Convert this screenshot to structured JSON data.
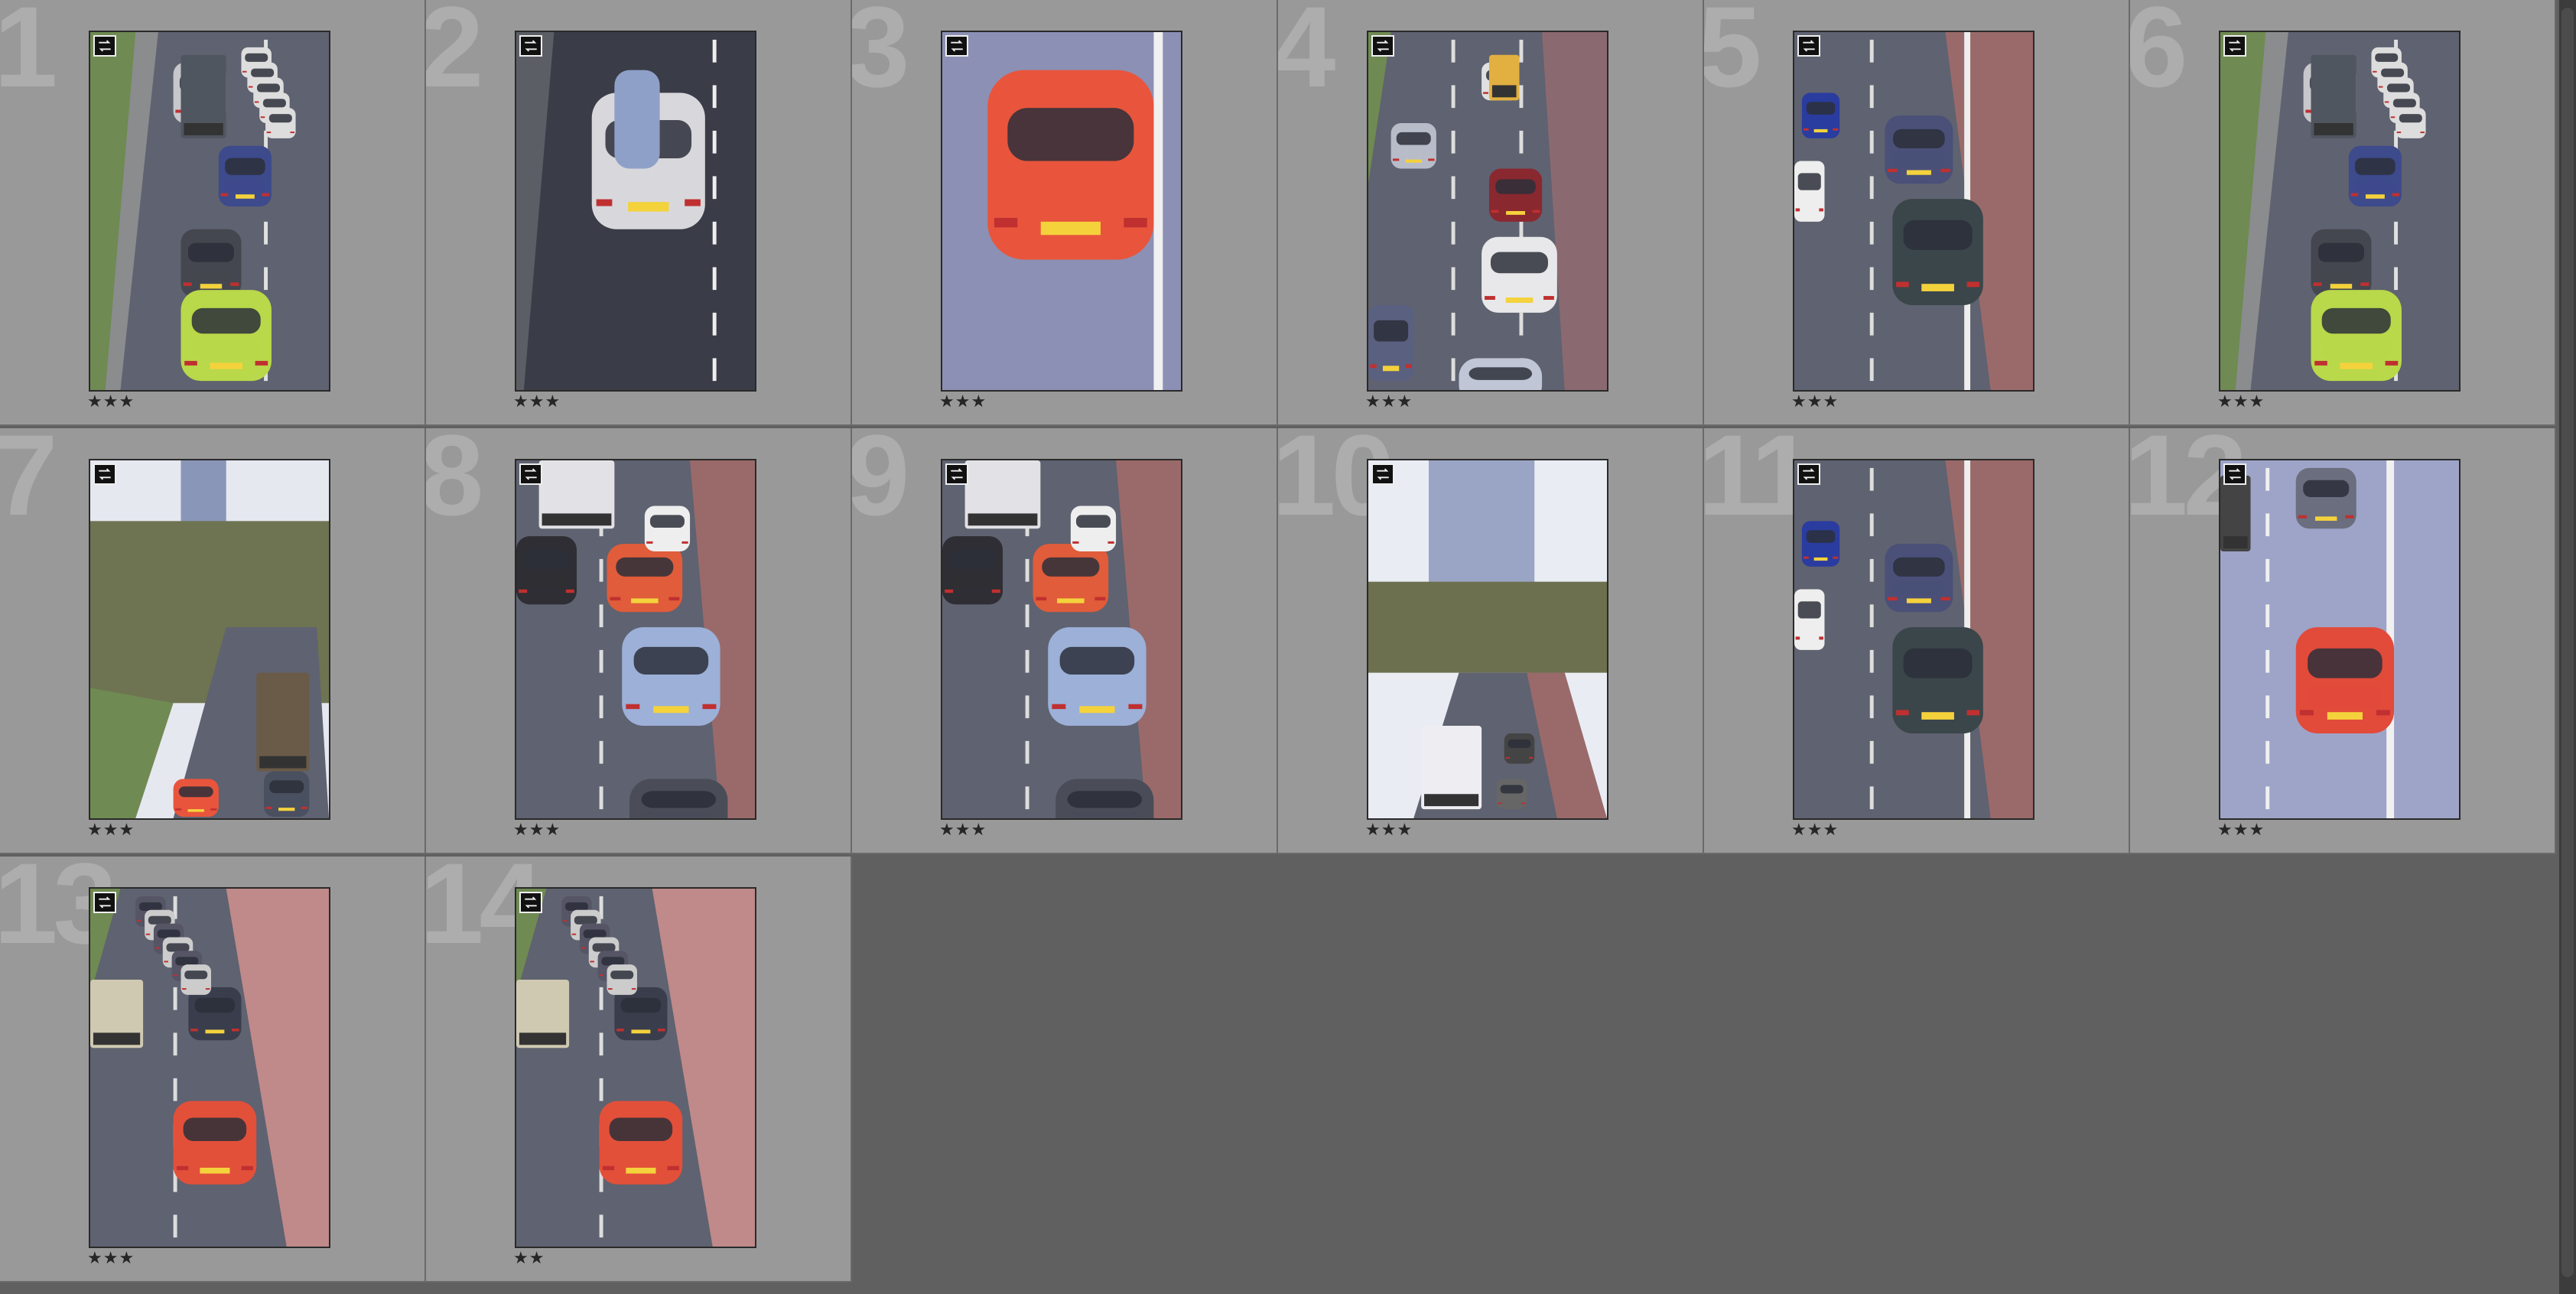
{
  "filmstrip": {
    "cells": [
      {
        "index": "1",
        "rating": "★★★",
        "scene": "wide-road",
        "badge": true
      },
      {
        "index": "2",
        "rating": "★★★",
        "scene": "white-car-cargo",
        "badge": true
      },
      {
        "index": "3",
        "rating": "★★★",
        "scene": "red-car-close",
        "badge": true
      },
      {
        "index": "4",
        "rating": "★★★",
        "scene": "traffic-lanes",
        "badge": true
      },
      {
        "index": "5",
        "rating": "★★★",
        "scene": "bus-lane",
        "badge": true
      },
      {
        "index": "6",
        "rating": "★★★",
        "scene": "wide-road",
        "badge": true
      },
      {
        "index": "7",
        "rating": "★★★",
        "scene": "tower-trees",
        "badge": true
      },
      {
        "index": "8",
        "rating": "★★★",
        "scene": "mini-queue",
        "badge": true
      },
      {
        "index": "9",
        "rating": "★★★",
        "scene": "mini-queue",
        "badge": true
      },
      {
        "index": "10",
        "rating": "★★★",
        "scene": "tower-road",
        "badge": true
      },
      {
        "index": "11",
        "rating": "★★★",
        "scene": "bus-lane",
        "badge": true
      },
      {
        "index": "12",
        "rating": "★★★",
        "scene": "red-mini-lane",
        "badge": true
      },
      {
        "index": "13",
        "rating": "★★★",
        "scene": "red-mini-queue",
        "badge": true
      },
      {
        "index": "14",
        "rating": "★★",
        "scene": "red-mini-queue",
        "badge": true
      }
    ]
  },
  "icon_names": {
    "badge": "swap-arrows-icon"
  },
  "colors": {
    "cell_bg": "#999999",
    "panel_bg": "#606060",
    "star": "#262626",
    "index_watermark": "#adadad"
  }
}
